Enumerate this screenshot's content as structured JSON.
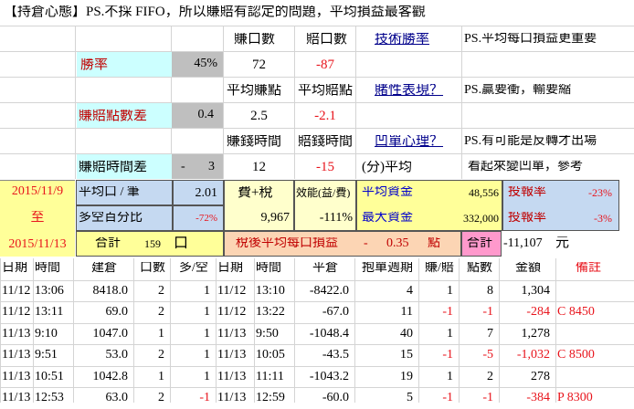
{
  "title_row": {
    "title": "【持倉心態】PS.不採 FIFO，所以賺賠有認定的問題，平均損益最客觀"
  },
  "stats": {
    "win_col_header": "賺口數",
    "loss_col_header": "賠口數",
    "tech_link": "技術勝率",
    "ps1": "PS.平均每口損益更重要",
    "win_rate_label": "勝率",
    "win_rate_value": "45%",
    "win_count": "72",
    "loss_count": "-87",
    "avg_win_header": "平均賺點",
    "avg_loss_header": "平均賠點",
    "gamble_link": "賭性表現？",
    "ps2": "PS.贏要衝，輸要縮",
    "pt_diff_label": "賺賠點數差",
    "pt_diff_value": "0.4",
    "avg_win": "2.5",
    "avg_loss": "-2.1",
    "win_time_header": "賺錢時間",
    "loss_time_header": "賠錢時間",
    "hold_link": "凹單心理？",
    "ps3": "PS.有可能是反轉才出場",
    "time_diff_label": "賺賠時間差",
    "time_diff_dash": "-",
    "time_diff_value": "3",
    "win_time": "12",
    "loss_time": "-15",
    "avg_unit": "(分)平均",
    "note": "看起來變凹單，參考"
  },
  "summary": {
    "date_start": "2015/11/9",
    "date_to": "至",
    "date_end": "2015/11/13",
    "avg_lot_label": "平均口 / 筆",
    "avg_lot_value": "2.01",
    "fee_tax_label": "費+稅",
    "fee_tax_value": "9,967",
    "efficiency_label": "效能(益/費)",
    "efficiency_value": "-111%",
    "avg_capital_label": "平均資金",
    "avg_capital_value": "48,556",
    "roi_label1": "投報率",
    "roi_value1": "-23%",
    "ls_pct_label": "多空百分比",
    "ls_pct_value": "-72%",
    "max_capital_label": "最大資金",
    "max_capital_value": "332,000",
    "roi_label2": "投報率",
    "roi_value2": "-3%",
    "total_label": "合計",
    "total_lots": "159",
    "lot_unit": "口",
    "after_tax_label": "稅後平均每口損益",
    "after_tax_dash": "-",
    "after_tax_value": "0.35",
    "after_tax_unit": "點",
    "total_label2": "合計",
    "total_amount": "-11,107",
    "yuan": "元"
  },
  "table": {
    "headers": [
      "日期",
      "時間",
      "建倉",
      "口數",
      "多/空",
      "日期",
      "時間",
      "平倉",
      "抱單週期",
      "賺/賠",
      "點數",
      "金額",
      "備註"
    ],
    "rows": [
      [
        "11/12",
        "13:06",
        "8418.0",
        "2",
        "1",
        "11/12",
        "13:10",
        "-8422.0",
        "4",
        "1",
        "8",
        "1,304",
        ""
      ],
      [
        "11/12",
        "13:11",
        "69.0",
        "2",
        "1",
        "11/12",
        "13:22",
        "-67.0",
        "11",
        "-1",
        "-1",
        "-284",
        "C 8450"
      ],
      [
        "11/13",
        "9:10",
        "1047.0",
        "1",
        "1",
        "11/13",
        "9:50",
        "-1048.4",
        "40",
        "1",
        "7",
        "1,278",
        ""
      ],
      [
        "11/13",
        "9:51",
        "53.0",
        "2",
        "1",
        "11/13",
        "10:05",
        "-43.5",
        "15",
        "-1",
        "-5",
        "-1,032",
        "C 8500"
      ],
      [
        "11/13",
        "10:51",
        "1042.8",
        "1",
        "1",
        "11/13",
        "11:11",
        "-1043.2",
        "19",
        "1",
        "2",
        "278",
        ""
      ],
      [
        "11/13",
        "12:53",
        "63.0",
        "2",
        "-1",
        "11/13",
        "12:59",
        "-60.0",
        "5",
        "-1",
        "-1",
        "-384",
        "P 8300"
      ]
    ]
  },
  "colors": {
    "yellow": "#ffff99",
    "light_blue": "#c5d9f1",
    "cyan_bg": "#ccffff",
    "gray": "#bfbfbf",
    "orange": "#fcd5b4",
    "pink": "#ff99cc",
    "pale_yellow": "#ffffcc",
    "red": "#e8141c"
  }
}
